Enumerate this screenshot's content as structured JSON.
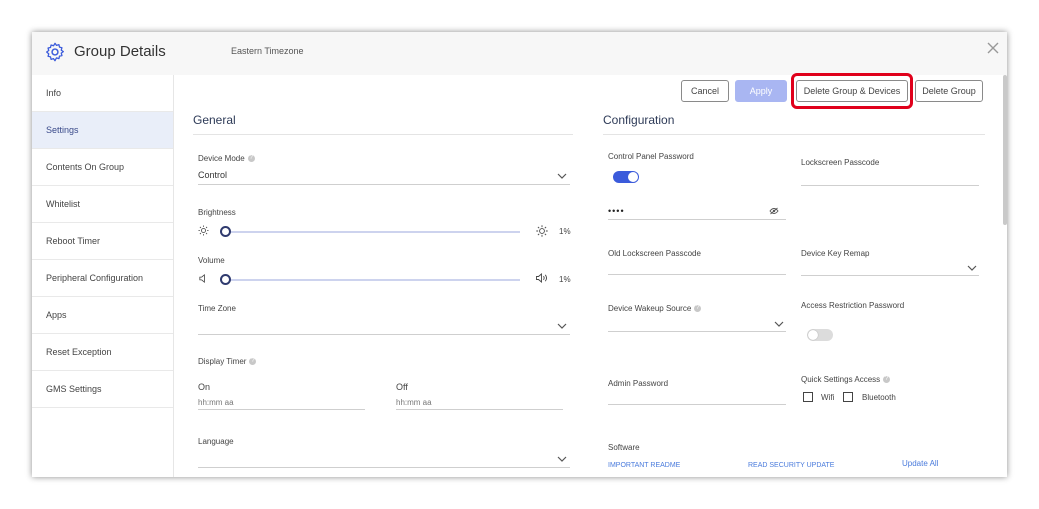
{
  "header": {
    "title": "Group Details",
    "timezone": "Eastern Timezone"
  },
  "sidebar": {
    "items": [
      {
        "label": "Info"
      },
      {
        "label": "Settings"
      },
      {
        "label": "Contents On Group"
      },
      {
        "label": "Whitelist"
      },
      {
        "label": "Reboot Timer"
      },
      {
        "label": "Peripheral Configuration"
      },
      {
        "label": "Apps"
      },
      {
        "label": "Reset Exception"
      },
      {
        "label": "GMS Settings"
      }
    ],
    "active_index": 1
  },
  "toolbar": {
    "cancel": "Cancel",
    "apply": "Apply",
    "delete_group_devices": "Delete Group & Devices",
    "delete_group": "Delete Group"
  },
  "general": {
    "title": "General",
    "device_mode": {
      "label": "Device Mode",
      "value": "Control"
    },
    "brightness": {
      "label": "Brightness",
      "value": "1%"
    },
    "volume": {
      "label": "Volume",
      "value": "1%"
    },
    "time_zone": {
      "label": "Time Zone",
      "value": ""
    },
    "display_timer": {
      "label": "Display Timer",
      "on_label": "On",
      "on_placeholder": "hh:mm aa",
      "off_label": "Off",
      "off_placeholder": "hh:mm aa"
    },
    "language": {
      "label": "Language",
      "value": ""
    }
  },
  "configuration": {
    "title": "Configuration",
    "control_panel_password": {
      "label": "Control Panel Password",
      "enabled": true,
      "value": "••••"
    },
    "lockscreen_passcode": {
      "label": "Lockscreen Passcode"
    },
    "old_lockscreen_passcode": {
      "label": "Old Lockscreen Passcode"
    },
    "device_key_remap": {
      "label": "Device Key Remap"
    },
    "device_wakeup_source": {
      "label": "Device Wakeup Source"
    },
    "access_restriction_password": {
      "label": "Access Restriction Password",
      "enabled": false
    },
    "admin_password": {
      "label": "Admin Password"
    },
    "quick_settings_access": {
      "label": "Quick Settings Access",
      "options": [
        {
          "label": "Wifi",
          "checked": false
        },
        {
          "label": "Bluetooth",
          "checked": false
        }
      ]
    },
    "software": {
      "label": "Software",
      "important_readme": "IMPORTANT README",
      "read_security_update": "READ SECURITY UPDATE",
      "update_all": "Update All"
    }
  },
  "colors": {
    "accent": "#3b5bdb",
    "apply_disabled": "#a9b6f2",
    "highlight": "#e0001b",
    "active_sidebar": "#e9eef9",
    "link": "#4a7bdc"
  }
}
